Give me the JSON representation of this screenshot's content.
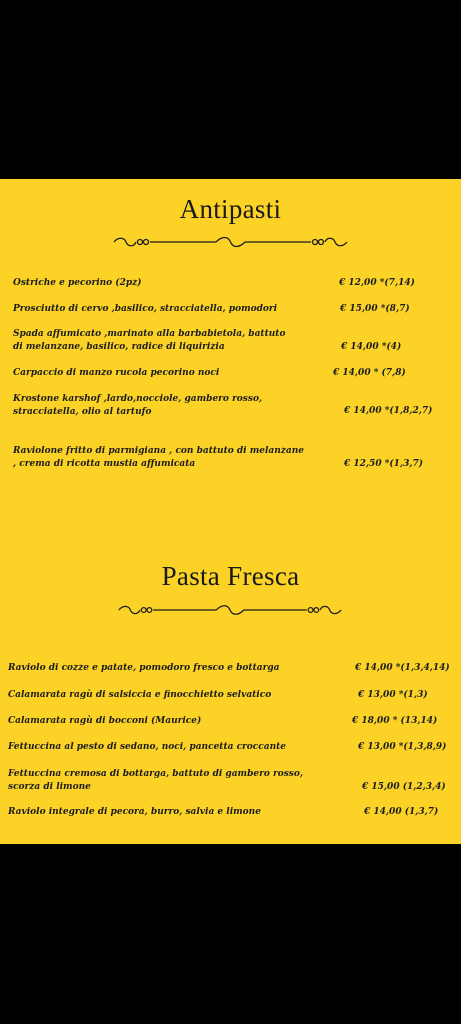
{
  "antipasti": {
    "title": "Antipasti",
    "items": [
      {
        "name": "Ostriche e pecorino  (2pz)",
        "price": "€ 12,00 *(7,14)"
      },
      {
        "name": "Prosciutto di cervo ,basilico, stracciatella, pomodori",
        "price": "€ 15,00 *(8,7)"
      },
      {
        "name_line1": "Spada affumicato ,marinato alla barbabietola, battuto",
        "name_line2": "di melanzane, basilico, radice di liquirizia",
        "price": "€ 14,00 *(4)"
      },
      {
        "name": "Carpaccio di manzo rucola pecorino noci",
        "price": "€ 14,00 * (7,8)"
      },
      {
        "name_line1": "Krostone karshof ,lardo,nocciole, gambero rosso,",
        "name_line2": "stracciatella, olio al tartufo",
        "price": "€ 14,00 *(1,8,2,7)"
      },
      {
        "name_line1": "Raviolone fritto di parmigiana , con battuto di melanzane",
        "name_line2": ", crema di ricotta mustia affumicata",
        "price": "€ 12,50 *(1,3,7)"
      }
    ]
  },
  "pasta_fresca": {
    "title": "Pasta Fresca",
    "items": [
      {
        "name": "Raviolo di cozze e patate, pomodoro fresco e bottarga",
        "price": "€ 14,00   *(1,3,4,14)"
      },
      {
        "name": "Calamarata ragù di salsiccia e finocchietto selvatico",
        "price": "€ 13,00 *(1,3)"
      },
      {
        "name": "Calamarata ragù di bocconi (Maurice)",
        "price": "€ 18,00 * (13,14)"
      },
      {
        "name": "Fettuccina al pesto di sedano, noci, pancetta croccante",
        "price": "€ 13,00 *(1,3,8,9)"
      },
      {
        "name_line1": "Fettuccina cremosa di bottarga, battuto di gambero rosso,",
        "name_line2": "scorza di limone",
        "price": "€ 15,00 (1,2,3,4)"
      },
      {
        "name": "Raviolo integrale di pecora, burro, salvia e limone",
        "price": "€ 14,00 (1,3,7)"
      }
    ]
  },
  "icons": {
    "divider": "ornamental-flourish-icon"
  },
  "colors": {
    "background": "#fcd227",
    "text": "#1c1c1c",
    "frame": "#000000"
  }
}
